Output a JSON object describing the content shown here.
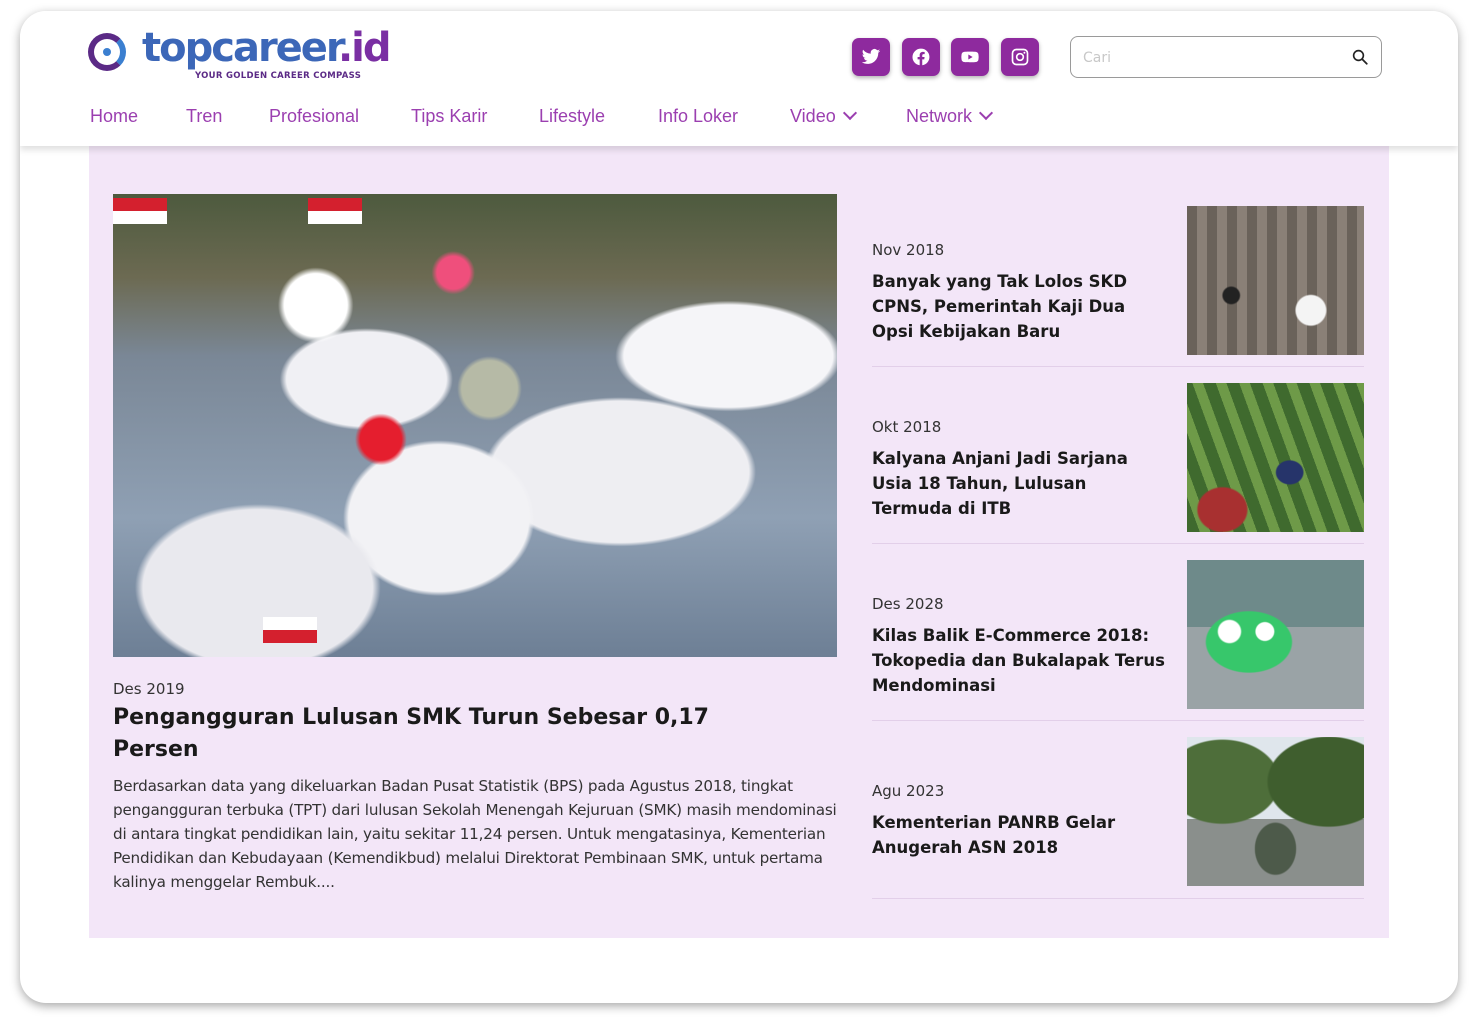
{
  "header": {
    "logo_main": "topcareer",
    "logo_suffix": ".id",
    "logo_tagline": "YOUR GOLDEN CAREER COMPASS",
    "social": [
      "twitter-icon",
      "facebook-icon",
      "youtube-icon",
      "instagram-icon"
    ],
    "search_placeholder": "Cari"
  },
  "nav": {
    "home": "Home",
    "tren": "Tren",
    "profesional": "Profesional",
    "tips_karir": "Tips Karir",
    "lifestyle": "Lifestyle",
    "info_loker": "Info Loker",
    "video": "Video",
    "network": "Network"
  },
  "main_article": {
    "date": "Des 2019",
    "title": "Pengangguran Lulusan SMK Turun Sebesar 0,17 Persen",
    "excerpt": "Berdasarkan data yang dikeluarkan Badan Pusat Statistik (BPS) pada Agustus 2018, tingkat pengangguran terbuka (TPT) dari lulusan Sekolah Menengah Kejuruan (SMK) masih mendominasi di antara tingkat pendidikan lain, yaitu sekitar 11,24 persen. Untuk mengatasinya, Kementerian Pendidikan dan Kebudayaan (Kemendikbud) melalui Direktorat Pembinaan SMK, untuk pertama kalinya menggelar Rembuk...."
  },
  "side_articles": [
    {
      "date": "Nov 2018",
      "title": "Banyak yang Tak Lolos SKD CPNS, Pemerintah Kaji Dua Opsi Kebijakan Baru"
    },
    {
      "date": "Okt 2018",
      "title": "Kalyana Anjani Jadi Sarjana Usia 18 Tahun, Lulusan Termuda di ITB"
    },
    {
      "date": "Des 2028",
      "title": "Kilas Balik E-Commerce 2018: Tokopedia dan Bukalapak Terus Mendominasi"
    },
    {
      "date": "Agu 2023",
      "title": "Kementerian PANRB Gelar Anugerah ASN 2018"
    }
  ],
  "colors": {
    "brand_purple": "#8e2a9e",
    "nav_text": "#9b3fb0",
    "panel_bg": "#f3e6f8"
  }
}
